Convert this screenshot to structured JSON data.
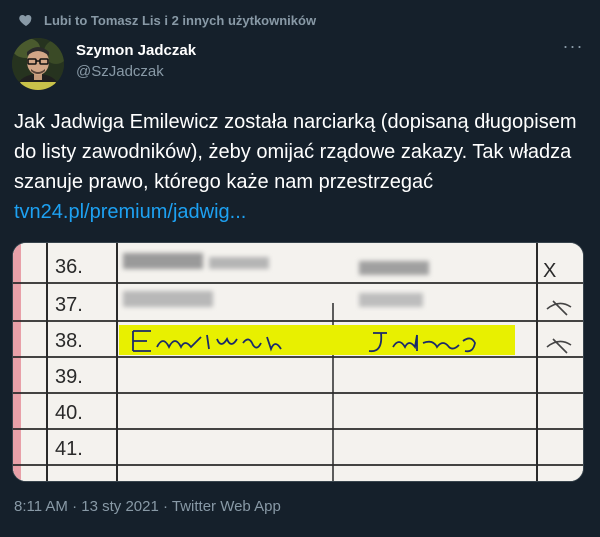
{
  "social_context": {
    "text": "Lubi to Tomasz Lis i 2 innych użytkowników"
  },
  "author": {
    "name": "Szymon Jadczak",
    "handle": "@SzJadczak"
  },
  "tweet": {
    "text": "Jak Jadwiga Emilewicz została narciarką (dopisaną długopisem do listy zawodników), żeby omijać rządowe zakazy. Tak władza szanuje prawo, którego każe nam przestrzegać ",
    "link": "tvn24.pl/premium/jadwig..."
  },
  "media": {
    "rows": [
      {
        "num": "36.",
        "mark": "X"
      },
      {
        "num": "37.",
        "mark": "✗"
      },
      {
        "num": "38.",
        "surname": "Emilewicz",
        "name": "Jadwiga",
        "mark": "✗"
      },
      {
        "num": "39.",
        "mark": ""
      },
      {
        "num": "40.",
        "mark": ""
      },
      {
        "num": "41.",
        "mark": ""
      }
    ]
  },
  "footer": {
    "time": "8:11 AM · 13 sty 2021 · Twitter Web App"
  },
  "colors": {
    "background": "#15202b",
    "muted": "#8899a6",
    "link": "#1da1f2",
    "highlight": "#e8f000"
  }
}
